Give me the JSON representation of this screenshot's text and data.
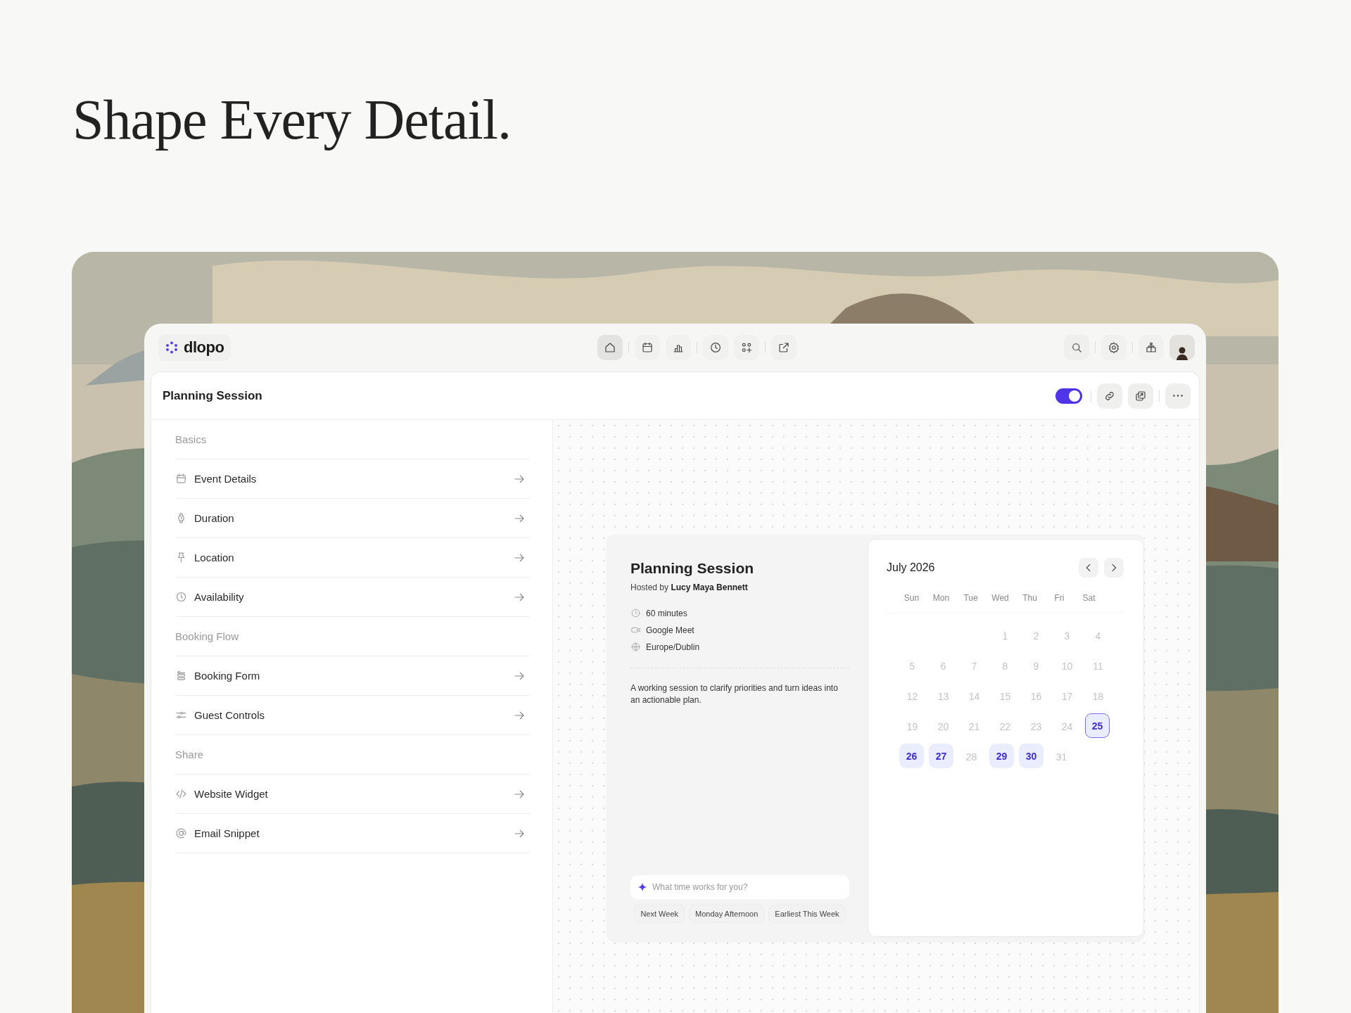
{
  "headline": "Shape Every Detail.",
  "app": {
    "logo": "dlopo",
    "nav": [
      {
        "kind": "home",
        "selected": true
      },
      {
        "kind": "calendar",
        "selected": false
      },
      {
        "kind": "chart",
        "selected": false
      },
      {
        "kind": "clock",
        "selected": false
      },
      {
        "kind": "apps",
        "selected": false
      },
      {
        "kind": "external",
        "selected": false
      }
    ],
    "page_title": "Planning Session",
    "published": {
      "on": true
    },
    "sections": [
      {
        "label": "Basics",
        "items": [
          {
            "kind": "calendar",
            "label": "Event Details"
          },
          {
            "kind": "watch",
            "label": "Duration"
          },
          {
            "kind": "pin",
            "label": "Location"
          },
          {
            "kind": "clock",
            "label": "Availability"
          }
        ]
      },
      {
        "label": "Booking Flow",
        "items": [
          {
            "kind": "form",
            "label": "Booking Form"
          },
          {
            "kind": "sliders",
            "label": "Guest Controls"
          }
        ]
      },
      {
        "label": "Share",
        "items": [
          {
            "kind": "code",
            "label": "Website Widget"
          },
          {
            "kind": "at",
            "label": "Email Snippet"
          }
        ]
      }
    ],
    "preview": {
      "title": "Planning Session",
      "host_prefix": "Hosted by",
      "host": "Lucy Maya Bennett",
      "facts": [
        {
          "kind": "clock",
          "text": "60 minutes"
        },
        {
          "kind": "video",
          "text": "Google Meet"
        },
        {
          "kind": "globe",
          "text": "Europe/Dublin"
        }
      ],
      "description": "A working session to clarify priorities and turn ideas into an actionable plan.",
      "ask": {
        "placeholder": "What time works for you?"
      },
      "suggestions": [
        "Next Week",
        "Monday Afternoon",
        "Earliest This Week"
      ],
      "calendar": {
        "month": "July",
        "year": "2026",
        "weekdays": [
          "Sun",
          "Mon",
          "Tue",
          "Wed",
          "Thu",
          "Fri",
          "Sat"
        ],
        "weeks": [
          {
            "kind": "offset",
            "days": [
              {
                "day": "1",
                "available": false,
                "selected": false
              },
              {
                "day": "2",
                "available": false,
                "selected": false
              },
              {
                "day": "3",
                "available": false,
                "selected": false
              },
              {
                "day": "4",
                "available": false,
                "selected": false
              }
            ]
          },
          {
            "kind": "plain",
            "days": [
              {
                "day": "5",
                "available": false,
                "selected": false
              },
              {
                "day": "6",
                "available": false,
                "selected": false
              },
              {
                "day": "7",
                "available": false,
                "selected": false
              },
              {
                "day": "8",
                "available": false,
                "selected": false
              },
              {
                "day": "9",
                "available": false,
                "selected": false
              },
              {
                "day": "10",
                "available": false,
                "selected": false
              },
              {
                "day": "11",
                "available": false,
                "selected": false
              }
            ]
          },
          {
            "kind": "plain",
            "days": [
              {
                "day": "12",
                "available": false,
                "selected": false
              },
              {
                "day": "13",
                "available": false,
                "selected": false
              },
              {
                "day": "14",
                "available": false,
                "selected": false
              },
              {
                "day": "15",
                "available": false,
                "selected": false
              },
              {
                "day": "16",
                "available": false,
                "selected": false
              },
              {
                "day": "17",
                "available": false,
                "selected": false
              },
              {
                "day": "18",
                "available": false,
                "selected": false
              }
            ]
          },
          {
            "kind": "plain",
            "days": [
              {
                "day": "19",
                "available": false,
                "selected": false
              },
              {
                "day": "20",
                "available": false,
                "selected": false
              },
              {
                "day": "21",
                "available": false,
                "selected": false
              },
              {
                "day": "22",
                "available": false,
                "selected": false
              },
              {
                "day": "23",
                "available": false,
                "selected": false
              },
              {
                "day": "24",
                "available": false,
                "selected": false
              },
              {
                "day": "25",
                "available": true,
                "selected": true
              }
            ]
          },
          {
            "kind": "plain",
            "days": [
              {
                "day": "26",
                "available": true,
                "selected": false
              },
              {
                "day": "27",
                "available": true,
                "selected": false
              },
              {
                "day": "28",
                "available": false,
                "selected": false
              },
              {
                "day": "29",
                "available": true,
                "selected": false
              },
              {
                "day": "30",
                "available": true,
                "selected": false
              },
              {
                "day": "31",
                "available": false,
                "selected": false
              }
            ]
          }
        ]
      }
    }
  }
}
